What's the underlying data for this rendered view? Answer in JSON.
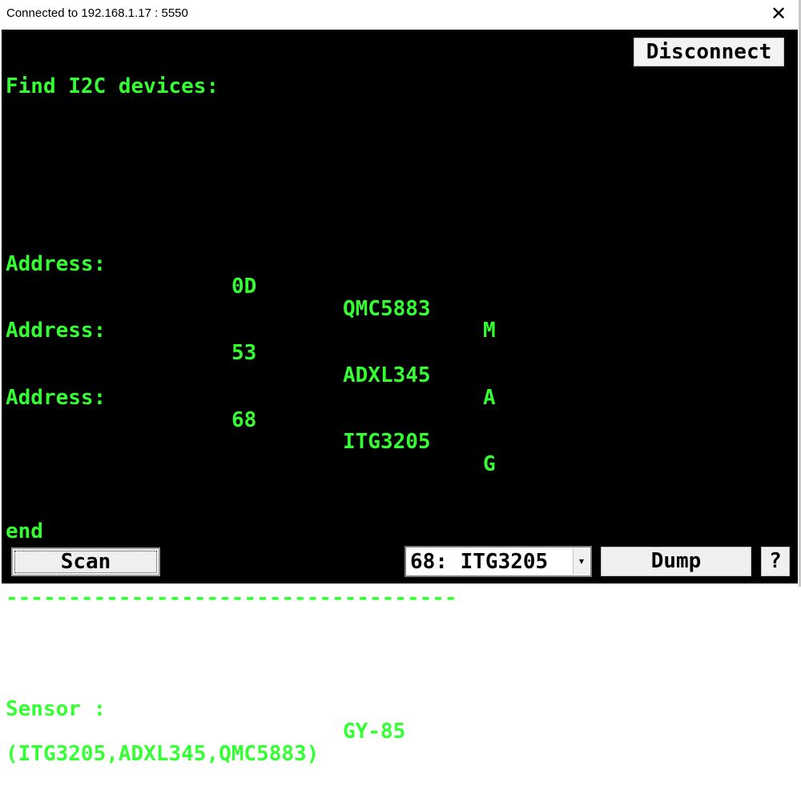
{
  "window": {
    "title": "Connected to 192.168.1.17 : 5550",
    "close_glyph": "✕"
  },
  "console": {
    "heading": "Find I2C devices:",
    "address_rows": [
      {
        "label": "Address:",
        "address": "0D",
        "chip": "QMC5883",
        "type": "M"
      },
      {
        "label": "Address:",
        "address": "53",
        "chip": "ADXL345",
        "type": "A"
      },
      {
        "label": "Address:",
        "address": "68",
        "chip": "ITG3205",
        "type": "G"
      }
    ],
    "end_text": "end",
    "separator": "------------------------------------",
    "sensor_label": "Sensor :",
    "sensor_name": "GY-85",
    "sensor_chips": "(ITG3205,ADXL345,QMC5883)"
  },
  "buttons": {
    "disconnect": "Disconnect",
    "scan": "Scan",
    "dump": "Dump",
    "help": "?"
  },
  "device_select": {
    "selected": "68: ITG3205",
    "arrow_icon": "▾"
  },
  "colors": {
    "console_background": "#000000",
    "console_text": "#33ff33"
  }
}
